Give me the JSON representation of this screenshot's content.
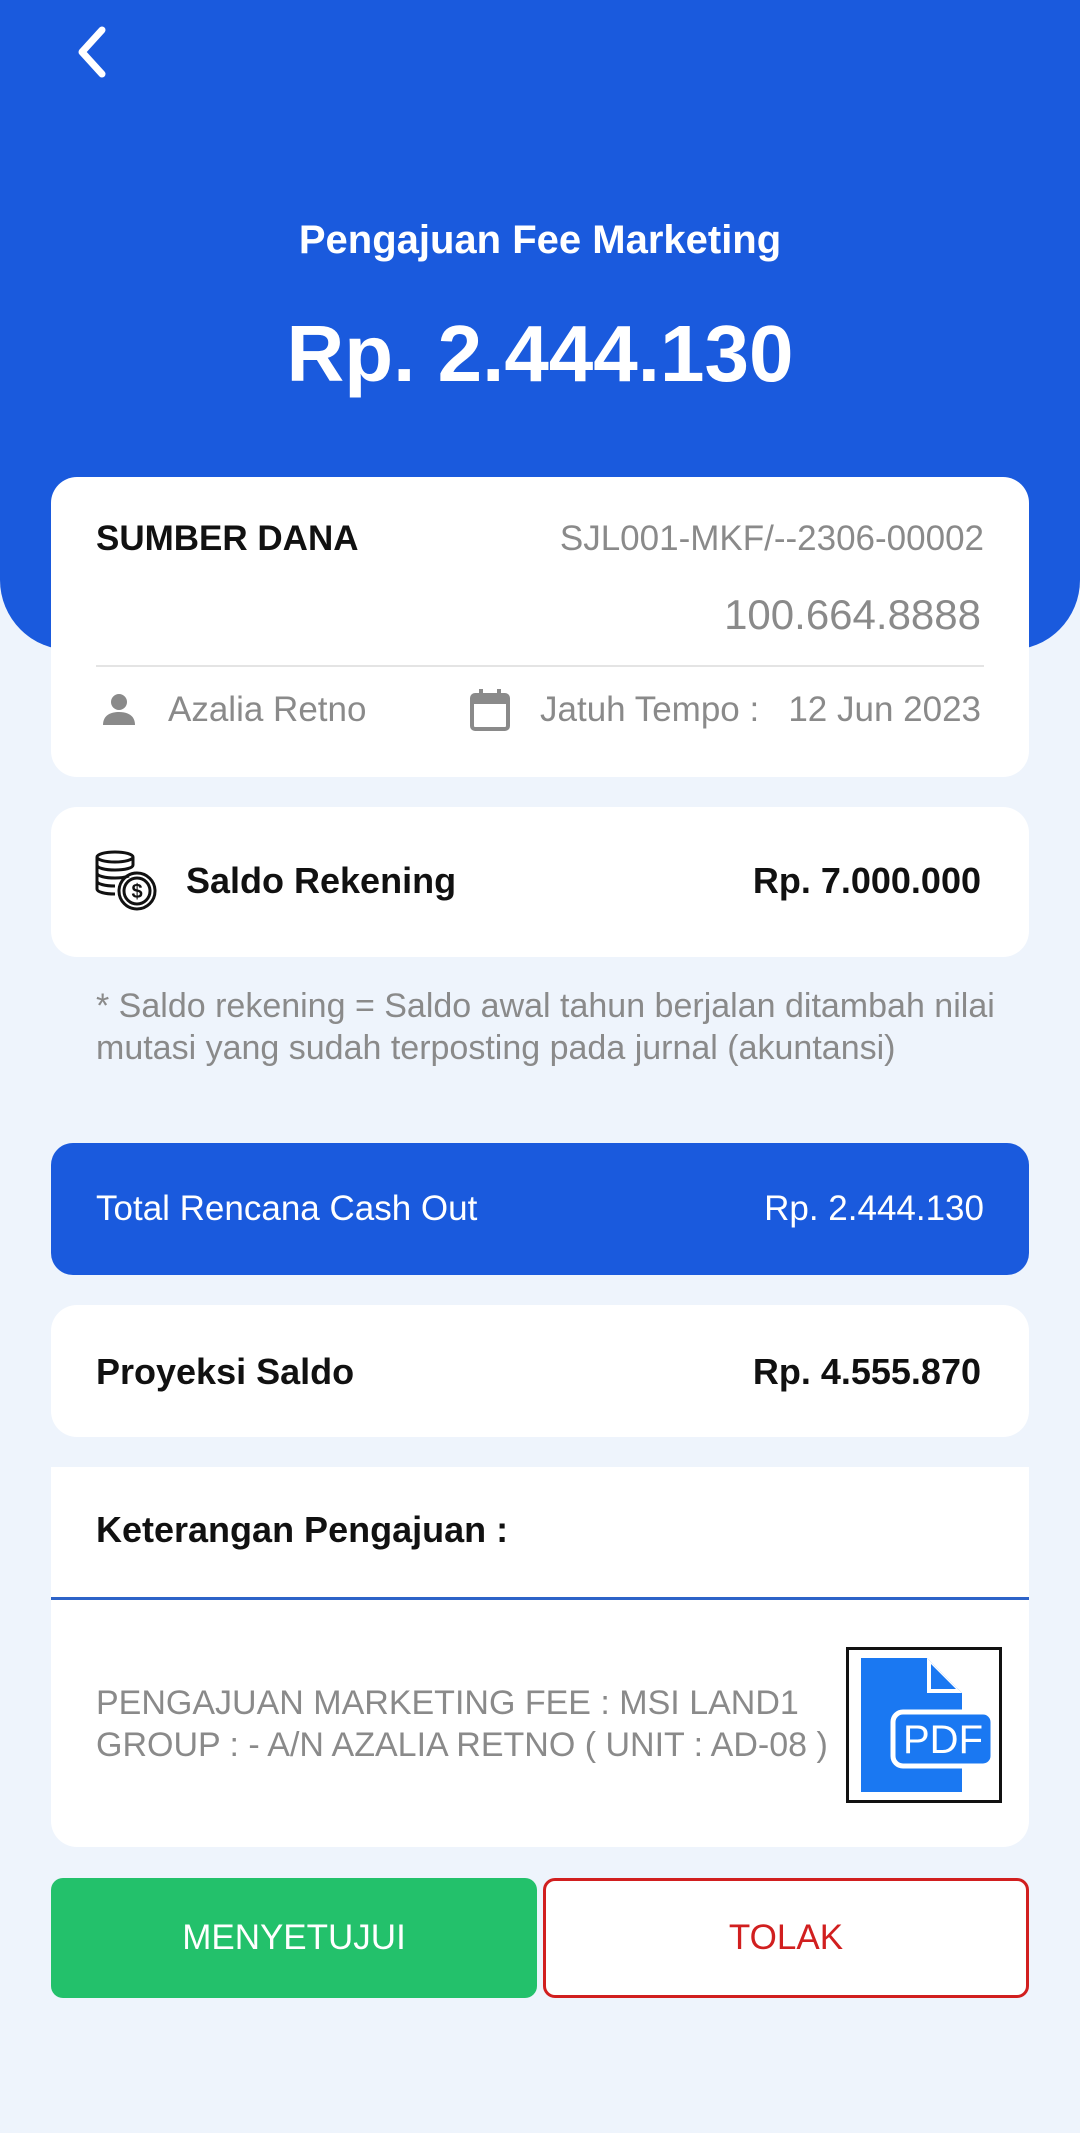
{
  "header": {
    "title": "Pengajuan Fee Marketing",
    "amount": "Rp. 2.444.130",
    "background_color": "#1a5add"
  },
  "sumber_dana": {
    "label": "SUMBER DANA",
    "code": "SJL001-MKF/--2306-00002",
    "number": "100.664.8888",
    "person": "Azalia Retno",
    "due_label": "Jatuh Tempo :",
    "due_date": "12 Jun 2023"
  },
  "saldo_rekening": {
    "label": "Saldo Rekening",
    "value": "Rp. 7.000.000"
  },
  "note": "* Saldo rekening = Saldo awal tahun berjalan ditambah nilai mutasi yang sudah terposting pada jurnal (akuntansi)",
  "cash_out": {
    "label": "Total Rencana Cash Out",
    "value": "Rp. 2.444.130"
  },
  "proyeksi": {
    "label": "Proyeksi Saldo",
    "value": "Rp. 4.555.870"
  },
  "keterangan": {
    "label": "Keterangan Pengajuan :",
    "text": "PENGAJUAN MARKETING FEE : MSI LAND1 GROUP : - A/N AZALIA RETNO ( UNIT : AD-08 )",
    "attachment_label": "PDF",
    "attachment_icon": "pdf-file-icon"
  },
  "actions": {
    "approve_label": "MENYETUJUI",
    "reject_label": "TOLAK",
    "approve_color": "#23c16b",
    "reject_color": "#d11f1f"
  }
}
